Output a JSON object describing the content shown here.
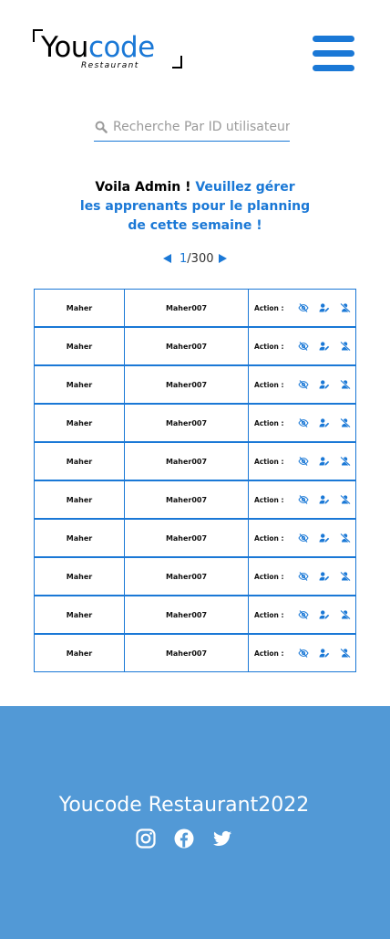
{
  "brand": {
    "word_black": "You",
    "word_blue": "code",
    "subtitle": "Restaurant"
  },
  "colors": {
    "accent": "#1a78d6",
    "footer_bg": "#5299d6"
  },
  "search": {
    "placeholder": "Recherche Par ID utilisateur",
    "value": ""
  },
  "greeting": {
    "black": "Voila Admin ! ",
    "blue_line1": "Veuillez gérer",
    "blue_line2": "les apprenants pour le planning",
    "blue_line3": "de cette semaine !"
  },
  "pagination": {
    "current": "1",
    "separator": "/",
    "total": "300"
  },
  "table": {
    "action_label": "Action :",
    "action_icons": [
      "eye-slash-icon",
      "user-edit-icon",
      "user-slash-icon"
    ],
    "rows": [
      {
        "name": "Maher",
        "user": "Maher007"
      },
      {
        "name": "Maher",
        "user": "Maher007"
      },
      {
        "name": "Maher",
        "user": "Maher007"
      },
      {
        "name": "Maher",
        "user": "Maher007"
      },
      {
        "name": "Maher",
        "user": "Maher007"
      },
      {
        "name": "Maher",
        "user": "Maher007"
      },
      {
        "name": "Maher",
        "user": "Maher007"
      },
      {
        "name": "Maher",
        "user": "Maher007"
      },
      {
        "name": "Maher",
        "user": "Maher007"
      },
      {
        "name": "Maher",
        "user": "Maher007"
      }
    ]
  },
  "footer": {
    "brand": "Youcode Restaurant2022",
    "socials": [
      "instagram-icon",
      "facebook-icon",
      "twitter-icon"
    ]
  }
}
